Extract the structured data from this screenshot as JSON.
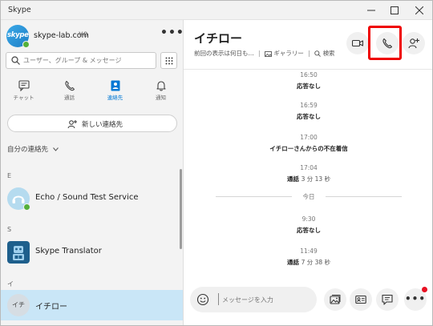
{
  "window": {
    "title": "Skype"
  },
  "account": {
    "avatar_text": "skype",
    "name": "skype-lab.com",
    "credit": "¥0"
  },
  "search": {
    "placeholder": "ユーザー、グループ & メッセージ"
  },
  "nav": {
    "chats": "チャット",
    "calls": "通話",
    "contacts": "連絡先",
    "notifications": "通知",
    "active": "contacts"
  },
  "sidebar": {
    "new_contact": "新しい連絡先",
    "my_contacts": "自分の連絡先",
    "sections": [
      {
        "letter": "E",
        "contact": "Echo / Sound Test Service"
      },
      {
        "letter": "S",
        "contact": "Skype Translator"
      },
      {
        "letter": "イ",
        "contact": "イチロー",
        "avatar_text": "イチ"
      }
    ]
  },
  "chat": {
    "title": "イチロー",
    "subtitle_last_seen": "前回の表示は何日も...",
    "gallery": "ギャラリー",
    "search": "検索",
    "messages": [
      {
        "time": "16:50",
        "text": "応答なし"
      },
      {
        "time": "16:59",
        "text": "応答なし"
      },
      {
        "time": "17:00",
        "text": "イチローさんからの不在着信"
      },
      {
        "time": "17:04",
        "text": "通話",
        "duration": "3 分 13 秒"
      },
      {
        "divider": "今日"
      },
      {
        "time": "9:30",
        "text": "応答なし"
      },
      {
        "time": "11:49",
        "text": "通話",
        "duration": "7 分 38 秒"
      }
    ]
  },
  "composer": {
    "placeholder": "メッセージを入力"
  },
  "colors": {
    "accent": "#0078d4",
    "highlight": "#ef0000",
    "online": "#55b03a",
    "selected_row": "#c9e6f7"
  }
}
